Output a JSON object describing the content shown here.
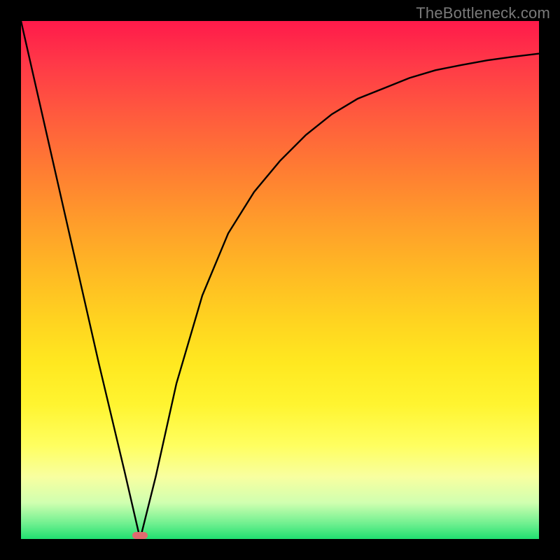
{
  "watermark": "TheBottleneck.com",
  "chart_data": {
    "type": "line",
    "title": "",
    "xlabel": "",
    "ylabel": "",
    "xlim": [
      0,
      1
    ],
    "ylim": [
      0,
      1
    ],
    "minimum": {
      "x": 0.23,
      "y": 0.0
    },
    "series": [
      {
        "name": "curve",
        "x": [
          0.0,
          0.05,
          0.1,
          0.15,
          0.2,
          0.23,
          0.26,
          0.3,
          0.35,
          0.4,
          0.45,
          0.5,
          0.55,
          0.6,
          0.65,
          0.7,
          0.75,
          0.8,
          0.85,
          0.9,
          0.95,
          1.0
        ],
        "y": [
          1.0,
          0.78,
          0.56,
          0.34,
          0.13,
          0.0,
          0.12,
          0.3,
          0.47,
          0.59,
          0.67,
          0.73,
          0.78,
          0.82,
          0.85,
          0.87,
          0.89,
          0.905,
          0.915,
          0.924,
          0.931,
          0.937
        ]
      }
    ],
    "gradient_stops": [
      {
        "pos": 0.0,
        "color": "#ff1a4a"
      },
      {
        "pos": 0.5,
        "color": "#ffd420"
      },
      {
        "pos": 0.88,
        "color": "#f8ffa0"
      },
      {
        "pos": 1.0,
        "color": "#20e070"
      }
    ]
  }
}
